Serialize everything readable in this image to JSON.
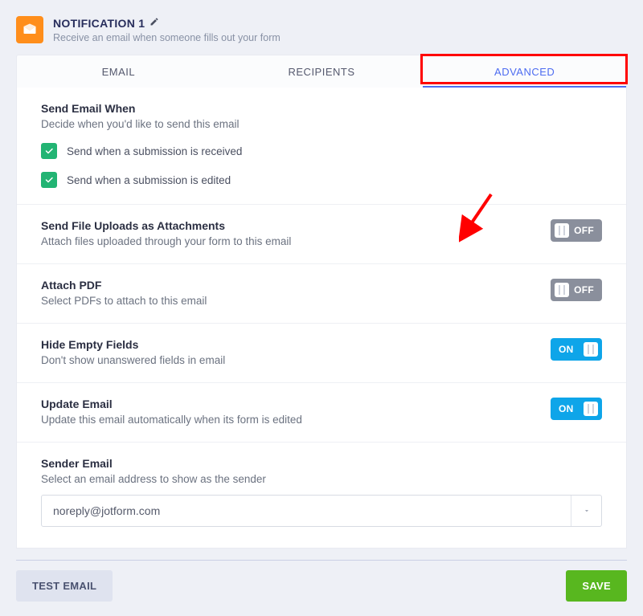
{
  "header": {
    "title": "NOTIFICATION 1",
    "subtitle": "Receive an email when someone fills out your form"
  },
  "tabs": {
    "email": "EMAIL",
    "recipients": "RECIPIENTS",
    "advanced": "ADVANCED"
  },
  "sendWhen": {
    "title": "Send Email When",
    "desc": "Decide when you'd like to send this email",
    "opt1": "Send when a submission is received",
    "opt2": "Send when a submission is edited"
  },
  "fileUploads": {
    "title": "Send File Uploads as Attachments",
    "desc": "Attach files uploaded through your form to this email",
    "state": "OFF"
  },
  "attachPdf": {
    "title": "Attach PDF",
    "desc": "Select PDFs to attach to this email",
    "state": "OFF"
  },
  "hideEmpty": {
    "title": "Hide Empty Fields",
    "desc": "Don't show unanswered fields in email",
    "state": "ON"
  },
  "updateEmail": {
    "title": "Update Email",
    "desc": "Update this email automatically when its form is edited",
    "state": "ON"
  },
  "senderEmail": {
    "title": "Sender Email",
    "desc": "Select an email address to show as the sender",
    "value": "noreply@jotform.com"
  },
  "footer": {
    "test": "TEST EMAIL",
    "save": "SAVE"
  }
}
